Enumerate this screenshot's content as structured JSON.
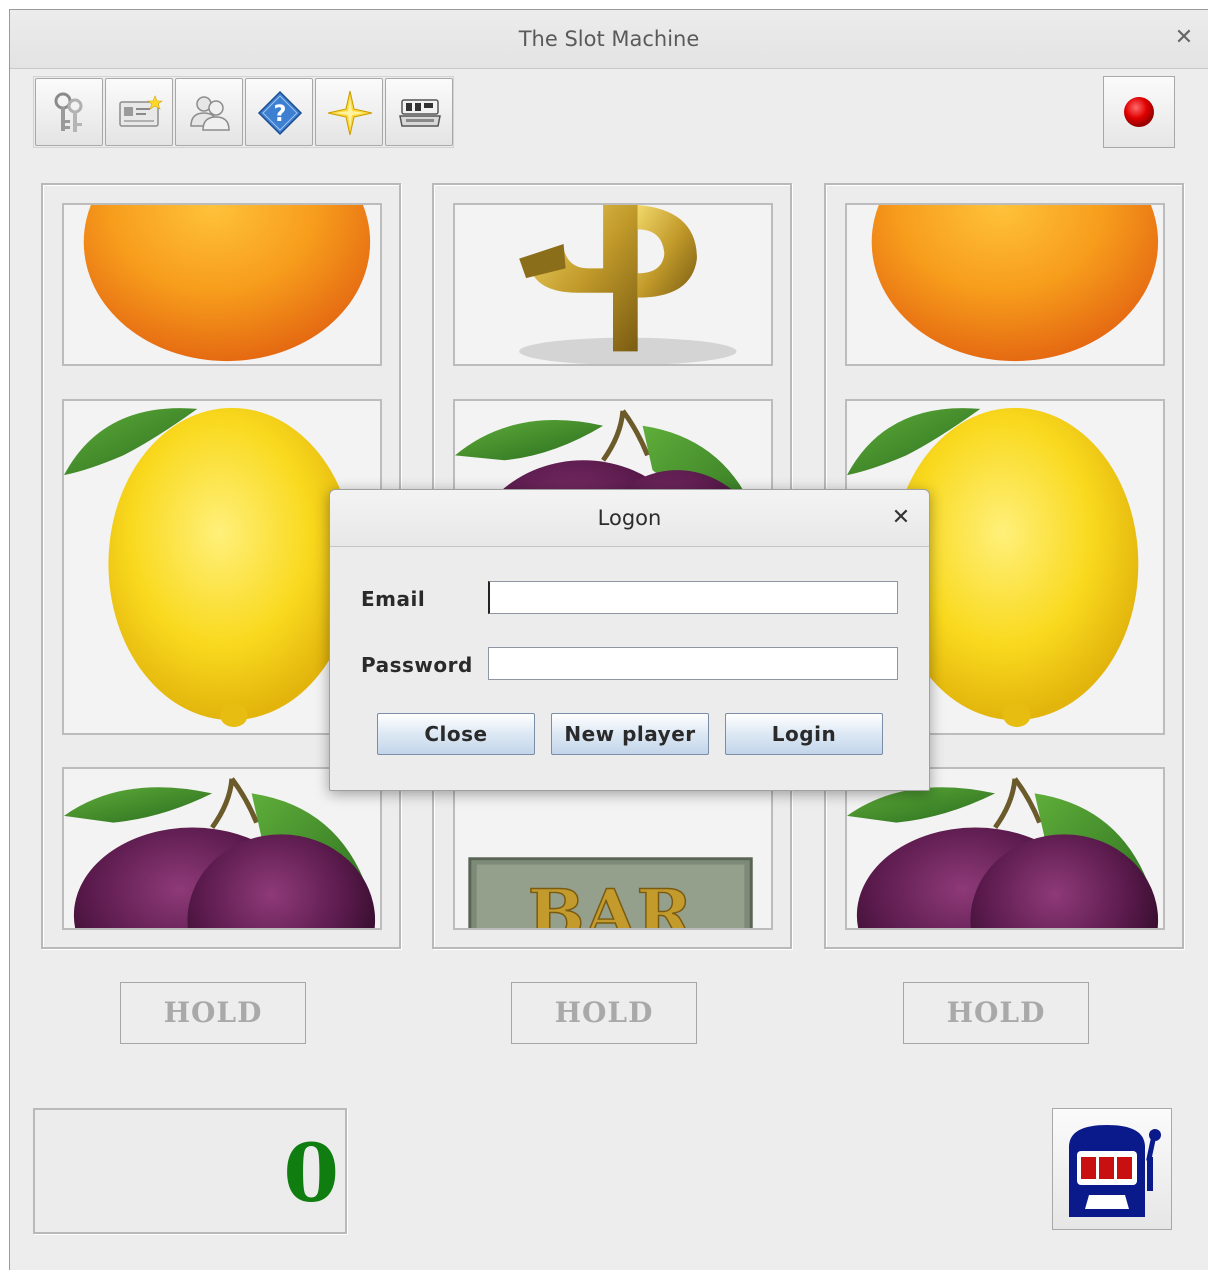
{
  "window": {
    "title": "The Slot Machine"
  },
  "toolbar": {
    "buttons": [
      {
        "icon": "keys-icon"
      },
      {
        "icon": "id-card-icon"
      },
      {
        "icon": "users-icon"
      },
      {
        "icon": "help-icon"
      },
      {
        "icon": "star-icon"
      },
      {
        "icon": "cash-register-icon"
      }
    ],
    "stop_icon": "red-record-icon"
  },
  "reels": [
    {
      "symbols": [
        "orange",
        "lemon",
        "plum"
      ]
    },
    {
      "symbols": [
        "dollar",
        "plum",
        "bar"
      ]
    },
    {
      "symbols": [
        "orange",
        "lemon",
        "plum"
      ]
    }
  ],
  "bar_symbol_text": "BAR",
  "hold_buttons": [
    "HOLD",
    "HOLD",
    "HOLD"
  ],
  "credit": {
    "value": "0"
  },
  "colors": {
    "credit": "#0f7d0f",
    "hold_text": "#a9a9a9",
    "stop": "#d40000"
  },
  "dialog": {
    "title": "Logon",
    "email_label": "Email",
    "password_label": "Password",
    "email_value": "",
    "password_value": "",
    "buttons": {
      "close": "Close",
      "new_player": "New player",
      "login": "Login"
    }
  }
}
